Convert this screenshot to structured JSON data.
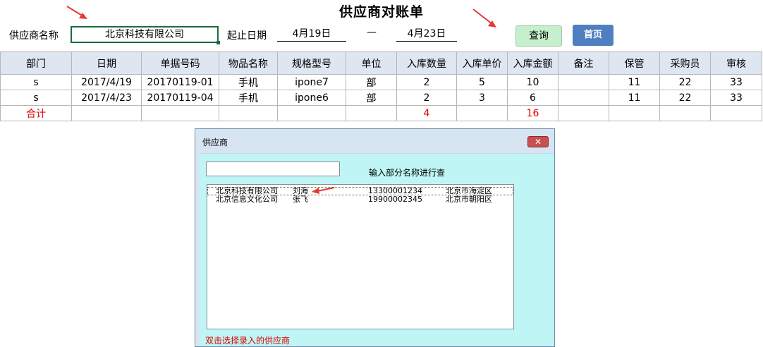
{
  "page": {
    "title": "供应商对账单"
  },
  "filters": {
    "supplier_label": "供应商名称",
    "supplier_value": "北京科技有限公司",
    "date_label": "起止日期",
    "start_date": "4月19日",
    "separator": "—",
    "end_date": "4月23日"
  },
  "buttons": {
    "query": "查询",
    "home": "首页"
  },
  "table": {
    "headers": [
      "部门",
      "日期",
      "单据号码",
      "物品名称",
      "规格型号",
      "单位",
      "入库数量",
      "入库单价",
      "入库金额",
      "备注",
      "保管",
      "采购员",
      "审核"
    ],
    "rows": [
      [
        "s",
        "2017/4/19",
        "20170119-01",
        "手机",
        "ipone7",
        "部",
        "2",
        "5",
        "10",
        "",
        "11",
        "22",
        "33"
      ],
      [
        "s",
        "2017/4/23",
        "20170119-04",
        "手机",
        "ipone6",
        "部",
        "2",
        "3",
        "6",
        "",
        "11",
        "22",
        "33"
      ]
    ],
    "total": {
      "label": "合计",
      "quantity": "4",
      "amount": "16"
    }
  },
  "dialog": {
    "title": "供应商",
    "close_icon": "close-x",
    "search_value": "",
    "hint": "输入部分名称进行查",
    "list": [
      {
        "company": "北京科技有限公司",
        "contact": "刘海",
        "phone": "13300001234",
        "address": "北京市海淀区"
      },
      {
        "company": "北京信息文化公司",
        "contact": "张飞",
        "phone": "19900002345",
        "address": "北京市朝阳区"
      }
    ],
    "footer": "双击选择录入的供应商"
  },
  "colors": {
    "header_bg": "#dde6f1",
    "query_btn": "#c6efce",
    "home_btn": "#4f7fc0",
    "dialog_bg": "#bff5f5",
    "total_text": "#e00000",
    "annotation_arrow": "#e53935"
  }
}
